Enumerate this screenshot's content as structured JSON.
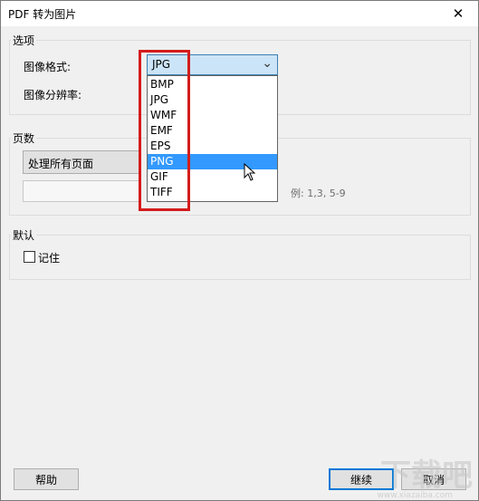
{
  "window": {
    "title": "PDF 转为图片",
    "close_glyph": "✕"
  },
  "options_group": {
    "label": "选项",
    "image_format_label": "图像格式:",
    "image_format_value": "JPG",
    "resolution_label": "图像分辨率:",
    "format_options": [
      "BMP",
      "JPG",
      "WMF",
      "EMF",
      "EPS",
      "PNG",
      "GIF",
      "TIFF"
    ],
    "hovered_option": "PNG"
  },
  "pages_group": {
    "label": "页数",
    "pages_value": "处理所有页面",
    "range_placeholder": "",
    "range_hint": "例: 1,3, 5-9"
  },
  "default_group": {
    "label": "默认",
    "remember_label": "记住",
    "remember_checked": false
  },
  "buttons": {
    "help": "帮助",
    "continue": "继续",
    "cancel": "取消"
  },
  "watermark": {
    "text": "下载吧",
    "sub": "www.xiazaiba.com"
  },
  "colors": {
    "accent": "#0078d7",
    "highlight_box": "#d41c1c",
    "hover": "#3399ff"
  }
}
